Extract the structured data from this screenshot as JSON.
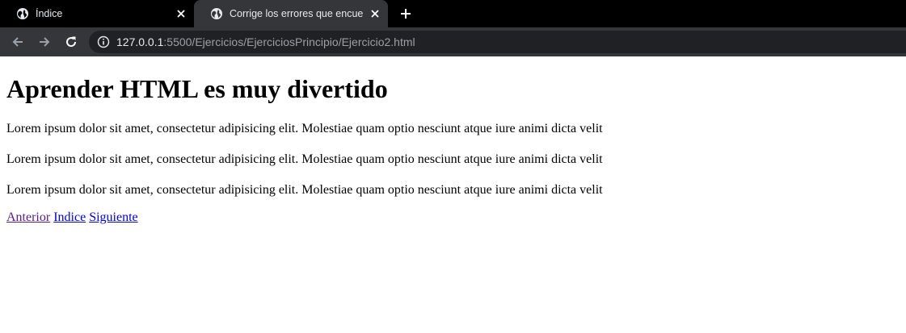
{
  "browser": {
    "tabs": [
      {
        "title": "Índice",
        "active": false
      },
      {
        "title": "Corrige los errores que encuentres",
        "active": true
      }
    ],
    "url_host": "127.0.0.1",
    "url_rest": ":5500/Ejercicios/EjerciciosPrincipio/Ejercicio2.html",
    "colors": {
      "tabbar": "#000000",
      "toolbar": "#35363a",
      "omnibox": "#202124"
    }
  },
  "page": {
    "heading": "Aprender HTML es muy divertido",
    "paragraphs": [
      "Lorem ipsum dolor sit amet, consectetur adipisicing elit. Molestiae quam optio nesciunt atque iure animi dicta velit",
      "Lorem ipsum dolor sit amet, consectetur adipisicing elit. Molestiae quam optio nesciunt atque iure animi dicta velit",
      "Lorem ipsum dolor sit amet, consectetur adipisicing elit. Molestiae quam optio nesciunt atque iure animi dicta velit"
    ],
    "links": {
      "previous": "Anterior",
      "index": "Indice",
      "next": "Siguiente"
    }
  }
}
